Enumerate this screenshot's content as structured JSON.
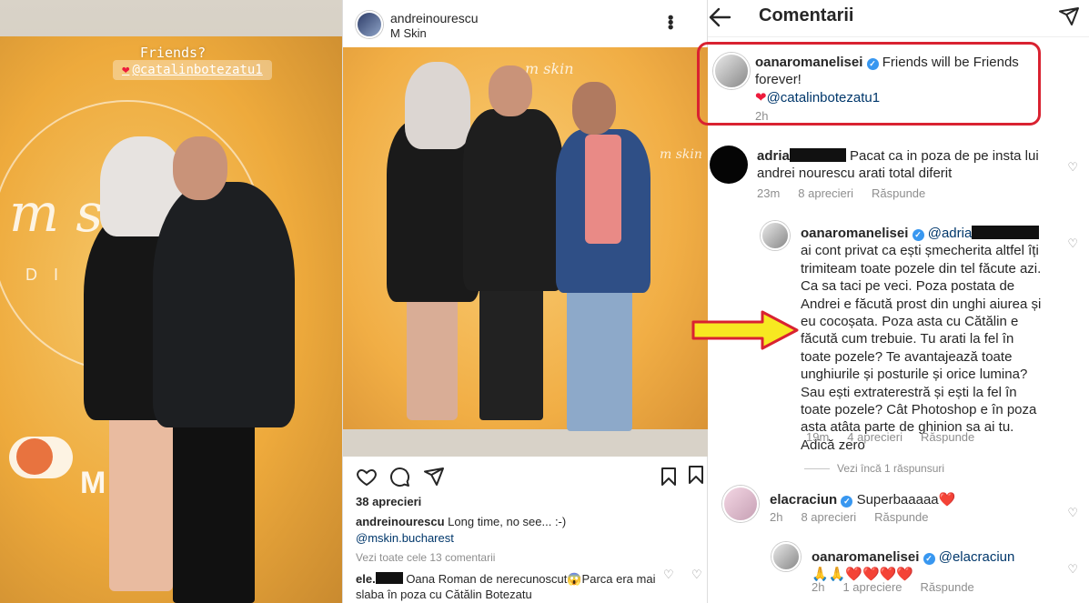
{
  "story": {
    "caption_top": "Friends?",
    "caption_tag": "@catalinbotezatu1",
    "brand_mark": "m skin",
    "brand_sub": "DI",
    "hospital_text": "MPITA"
  },
  "post": {
    "username": "andreinourescu",
    "location": "M Skin",
    "photo_mark": "m skin",
    "likes": "38 aprecieri",
    "caption_user": "andreinourescu",
    "caption_text": "Long time, no see... :-)",
    "mention": "@mskin.bucharest",
    "view_all": "Vezi toate cele 13 comentarii",
    "comment_user": "ele.",
    "comment_text": "Oana Roman de nerecunoscut😱Parca era mai slaba în poza cu Cătălin Botezatu"
  },
  "comments": {
    "title": "Comentarii",
    "items": [
      {
        "user": "oanaromanelisei",
        "text": "Friends will be Friends forever!",
        "tag": "@catalinbotezatu1",
        "time": "2h"
      },
      {
        "user": "adria",
        "text": "Pacat ca in poza de pe insta lui andrei nourescu arati total diferit",
        "time": "23m",
        "likes": "8 aprecieri",
        "reply": "Răspunde"
      },
      {
        "user": "oanaromanelisei",
        "mention": "@adria",
        "text": "ai cont privat ca ești șmecherita altfel îți trimiteam toate pozele din tel făcute azi. Ca sa taci pe veci. Poza postata de Andrei e făcută prost din unghi aiurea și eu cocoșata. Poza asta cu Cătălin e făcută cum trebuie. Tu arati la fel în toate pozele? Te avantajează toate unghiurile și posturile și orice lumina? Sau ești extraterestră și ești la fel în toate pozele?  Cât Photoshop e în poza asta atâta parte de ghinion sa ai tu. Adică zero",
        "time": "19m",
        "likes": "4 aprecieri",
        "reply": "Răspunde"
      },
      {
        "more_replies": "Vezi încă 1 răspunsuri"
      },
      {
        "user": "elacraciun",
        "text": "Superbaaaaa❤️",
        "time": "2h",
        "likes": "8 aprecieri",
        "reply": "Răspunde"
      },
      {
        "user": "oanaromanelisei",
        "mention": "@elacraciun",
        "text": "🙏🙏❤️❤️❤️❤️",
        "time": "2h",
        "likes": "1 apreciere",
        "reply": "Răspunde"
      }
    ]
  },
  "colors": {
    "highlight": "#d92231",
    "arrow_fill": "#f7e821",
    "arrow_stroke": "#d92231",
    "verified": "#3897f0",
    "link": "#00376b"
  }
}
